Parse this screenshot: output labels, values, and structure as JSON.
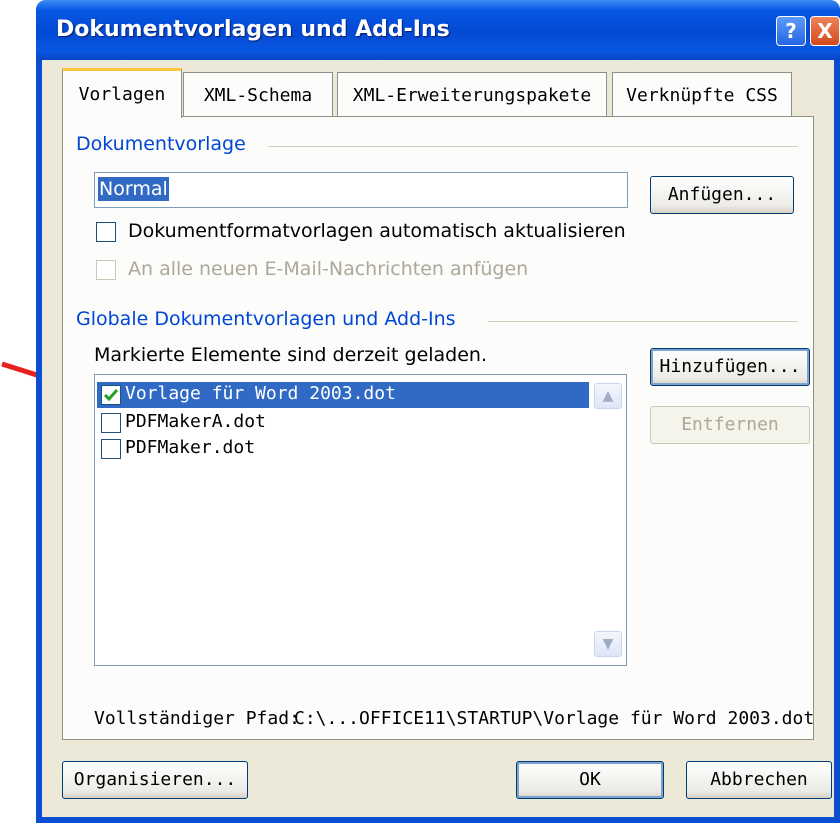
{
  "window": {
    "title": "Dokumentvorlagen und Add-Ins",
    "help_label": "?",
    "close_label": "X"
  },
  "tabs": [
    {
      "label": "Vorlagen",
      "active": true
    },
    {
      "label": "XML-Schema",
      "active": false
    },
    {
      "label": "XML-Erweiterungspakete",
      "active": false
    },
    {
      "label": "Verknüpfte CSS",
      "active": false
    }
  ],
  "dokumentvorlage": {
    "group_label": "Dokumentvorlage",
    "template_value": "Normal",
    "attach_button": "Anfügen...",
    "auto_update": {
      "label": "Dokumentformatvorlagen automatisch aktualisieren",
      "checked": false
    },
    "attach_email": {
      "label": "An alle neuen E-Mail-Nachrichten anfügen",
      "checked": false,
      "disabled": true
    }
  },
  "global": {
    "group_label": "Globale Dokumentvorlagen und Add-Ins",
    "loaded_note": "Markierte Elemente sind derzeit geladen.",
    "items": [
      {
        "label": "Vorlage für Word 2003.dot",
        "checked": true,
        "selected": true
      },
      {
        "label": "PDFMakerA.dot",
        "checked": false,
        "selected": false
      },
      {
        "label": "PDFMaker.dot",
        "checked": false,
        "selected": false
      }
    ],
    "add_button": "Hinzufügen...",
    "remove_button": "Entfernen",
    "path_label": "Vollständiger Pfad:",
    "path_value": "C:\\...OFFICE11\\STARTUP\\Vorlage für Word 2003.dot"
  },
  "footer": {
    "organize_button": "Organisieren...",
    "ok_button": "OK",
    "cancel_button": "Abbrechen"
  },
  "colors": {
    "titlebar": "#0349d3",
    "selection": "#316ac5",
    "group_label": "#0046d5",
    "annotation_arrow": "#e8201f"
  }
}
